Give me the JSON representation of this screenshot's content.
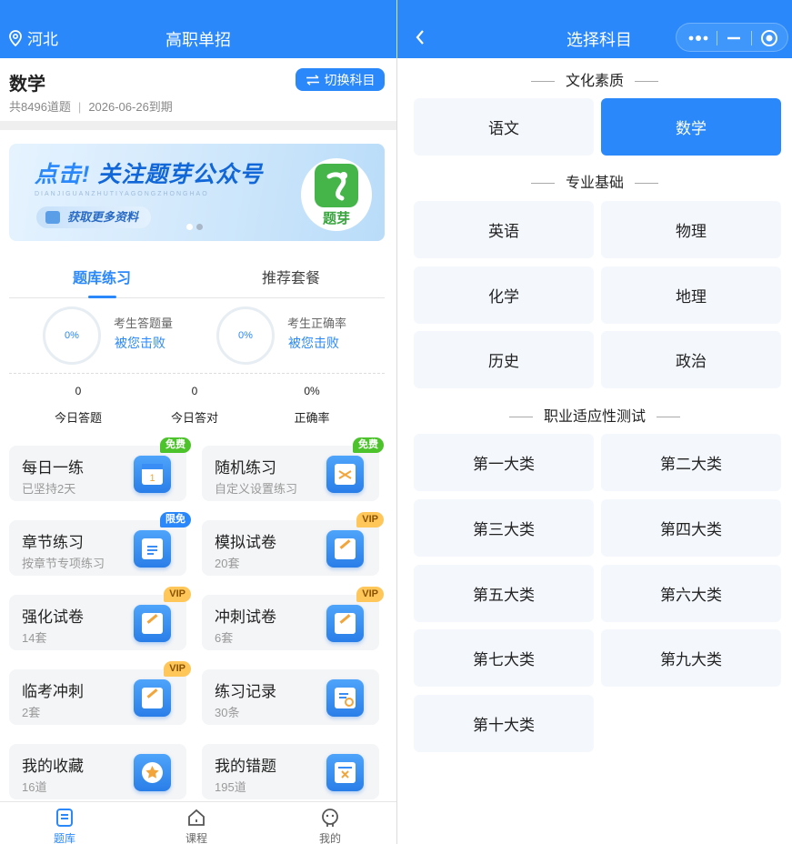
{
  "left": {
    "location": "河北",
    "title": "高职单招",
    "subject": "数学",
    "question_count": "共8496道题",
    "expiry": "2026-06-26到期",
    "switch_label": "切换科目",
    "banner": {
      "title_highlight": "点击!",
      "title_rest": "关注题芽公众号",
      "subtitle": "DIANJIGUANZHUTIYAGONGZHONGHAO",
      "pill": "获取更多资料",
      "logo_text": "题芽"
    },
    "tabs": [
      "题库练习",
      "推荐套餐"
    ],
    "stats": [
      {
        "percent": "0%",
        "label": "考生答题量",
        "link": "被您击败"
      },
      {
        "percent": "0%",
        "label": "考生正确率",
        "link": "被您击败"
      }
    ],
    "today": [
      {
        "value": "0",
        "label": "今日答题"
      },
      {
        "value": "0",
        "label": "今日答对"
      },
      {
        "value": "0%",
        "label": "正确率"
      }
    ],
    "cards": [
      {
        "title": "每日一练",
        "sub": "已坚持2天",
        "badge": "免费",
        "badge_type": "free",
        "icon": "calendar-icon"
      },
      {
        "title": "随机练习",
        "sub": "自定义设置练习",
        "badge": "免费",
        "badge_type": "free",
        "icon": "shuffle-icon"
      },
      {
        "title": "章节练习",
        "sub": "按章节专项练习",
        "badge": "限免",
        "badge_type": "limit",
        "icon": "document-icon"
      },
      {
        "title": "模拟试卷",
        "sub": "20套",
        "badge": "VIP",
        "badge_type": "vip",
        "icon": "pencil-paper-icon"
      },
      {
        "title": "强化试卷",
        "sub": "14套",
        "badge": "VIP",
        "badge_type": "vip",
        "icon": "pencil-paper-icon"
      },
      {
        "title": "冲刺试卷",
        "sub": "6套",
        "badge": "VIP",
        "badge_type": "vip",
        "icon": "pencil-paper-icon"
      },
      {
        "title": "临考冲刺",
        "sub": "2套",
        "badge": "VIP",
        "badge_type": "vip",
        "icon": "pencil-paper-icon"
      },
      {
        "title": "练习记录",
        "sub": "30条",
        "badge": "",
        "badge_type": "",
        "icon": "record-icon"
      },
      {
        "title": "我的收藏",
        "sub": "16道",
        "badge": "",
        "badge_type": "",
        "icon": "star-icon"
      },
      {
        "title": "我的错题",
        "sub": "195道",
        "badge": "",
        "badge_type": "",
        "icon": "wrong-answer-icon"
      }
    ],
    "tabbar": [
      "题库",
      "课程",
      "我的"
    ]
  },
  "right": {
    "title": "选择科目",
    "sections": [
      {
        "title": "文化素质",
        "items": [
          "语文",
          "数学"
        ],
        "selected": "数学"
      },
      {
        "title": "专业基础",
        "items": [
          "英语",
          "物理",
          "化学",
          "地理",
          "历史",
          "政治"
        ]
      },
      {
        "title": "职业适应性测试",
        "items": [
          "第一大类",
          "第二大类",
          "第三大类",
          "第四大类",
          "第五大类",
          "第六大类",
          "第七大类",
          "第九大类",
          "第十大类"
        ]
      }
    ]
  },
  "colors": {
    "primary": "#2a88fb",
    "free_badge": "#4cc22b",
    "vip_badge": "#ffc65a",
    "card_bg": "#f4f5f7",
    "option_bg": "#f4f8fd"
  }
}
